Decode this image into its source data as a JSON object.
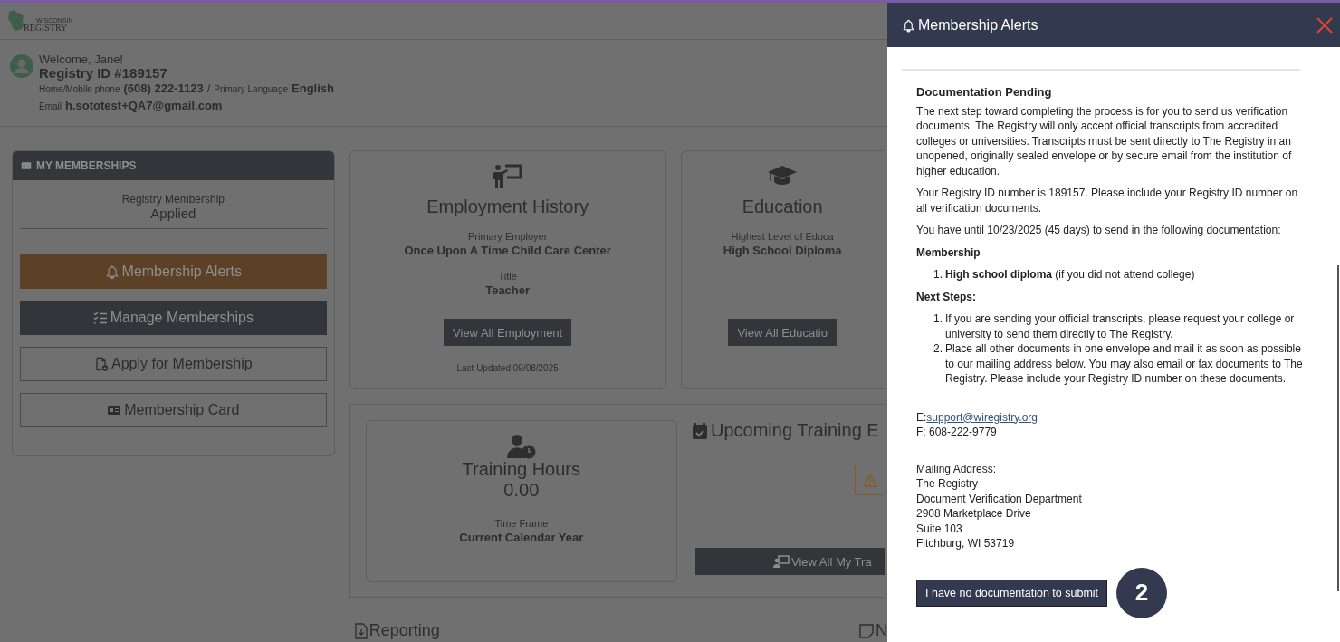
{
  "header": {
    "logo": {
      "small": "WISCONSIN",
      "large": "REGISTRY"
    }
  },
  "profile": {
    "welcome": "Welcome, Jane!",
    "registry_id": "Registry ID  #189157",
    "phone_label": "Home/Mobile phone",
    "phone": "(608) 222-1123",
    "separator": "/",
    "language_label": "Primary Language",
    "language": "English",
    "email_label": "Email",
    "email": "h.sototest+QA7@gmail.com"
  },
  "memberships": {
    "title": "MY MEMBERSHIPS",
    "label": "Registry Membership",
    "status": "Applied",
    "buttons": [
      {
        "label": "Membership Alerts",
        "kind": "alert"
      },
      {
        "label": "Manage Memberships",
        "kind": "dark"
      },
      {
        "label": "Apply for Membership",
        "kind": "outline"
      },
      {
        "label": "Membership Card",
        "kind": "outline"
      }
    ]
  },
  "employment": {
    "title": "Employment History",
    "fields": [
      {
        "label": "Primary Employer",
        "value": "Once Upon A Time Child Care Center"
      },
      {
        "label": "Title",
        "value": "Teacher"
      }
    ],
    "button": "View All Employment",
    "updated": "Last Updated 09/08/2025"
  },
  "education": {
    "title": "Education",
    "fields": [
      {
        "label": "Highest Level of Educa",
        "value": "High School Diploma"
      }
    ],
    "button": "View All Educatio"
  },
  "training": {
    "title": "Training Hours",
    "hours": "0.00",
    "label": "Time Frame",
    "value": "Current Calendar Year"
  },
  "upcoming": {
    "title": "Upcoming Training E",
    "button": "View All My Tra"
  },
  "reporting": {
    "title": "Reporting",
    "notes_title": "N"
  },
  "drawer": {
    "title": "Membership Alerts",
    "section_title": "Documentation Pending",
    "paragraphs": [
      "The next step toward completing the process is for you to send us verification documents. The Registry will only accept official transcripts from accredited colleges or universities. Transcripts must be sent directly to The Registry in an unopened, originally sealed envelope or by secure email from the institution of higher education.",
      "Your Registry ID number is 189157. Please include your Registry ID number on all verification documents.",
      "You have until 10/23/2025 (45 days) to send in the following documentation:"
    ],
    "membership_heading": "Membership",
    "membership_items": [
      {
        "number": "1.",
        "text": "**High school diploma** (if you did not attend college)"
      }
    ],
    "next_steps_heading": "Next Steps:",
    "next_steps": [
      {
        "number": "1.",
        "text": "If you are sending your official transcripts, please request your college or university to send them directly to The Registry."
      },
      {
        "number": "2.",
        "text": "Place all other documents in one envelope and mail it as soon as possible to our mailing address below. You may also email or fax documents to The Registry. Please include your Registry ID number on these documents."
      }
    ],
    "email_label": "E:",
    "email": "support@wiregistry.org",
    "fax": "F: 608-222-9779",
    "address_lines": [
      "Mailing Address:",
      "The Registry",
      "Document Verification Department",
      "2908 Marketplace Drive",
      "Suite 103",
      "Fitchburg, WI 53719"
    ],
    "submit_button": "I have no documentation to submit",
    "step_badge": "2"
  }
}
